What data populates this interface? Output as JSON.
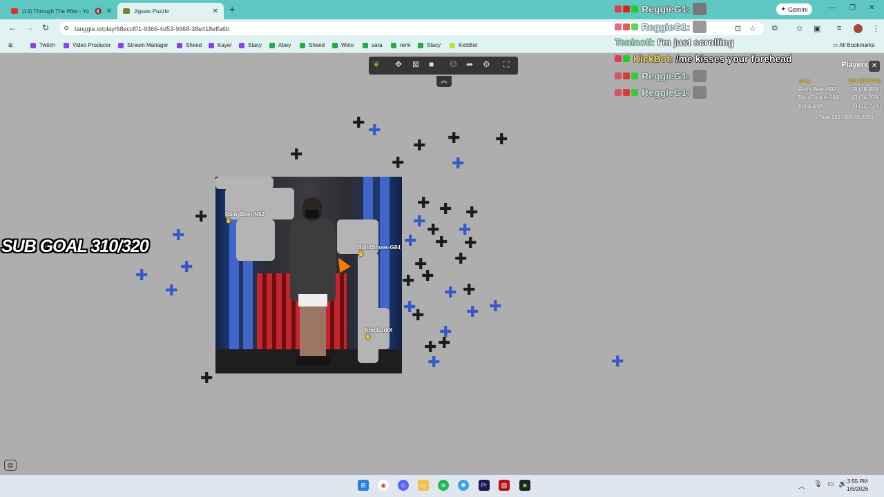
{
  "browser": {
    "tabs": [
      {
        "title": "(14) Through The Wire - Yo",
        "active": false
      },
      {
        "title": "Jigsaw Puzzle",
        "active": true
      }
    ],
    "new_tab": "+",
    "gemini": "Gemini",
    "url": "tanggle.io/play/68eccf01-9366-4d53-9968-38e418effa6b",
    "bookmarks": [
      "Twitch",
      "Video Producer",
      "Stream Manager",
      "Sheed",
      "Kayel",
      "Stacy",
      "Abey",
      "Sheed",
      "Welo",
      "sara",
      "remi",
      "Stacy",
      "KickBot"
    ],
    "all_bookmarks": "All Bookmarks",
    "colors": {
      "tabbar": "#5fc7c2",
      "toolbar": "#e0f3f2",
      "canvas": "#aeaeae"
    }
  },
  "puzzle": {
    "cursor_labels": [
      "RainyBeer-N92",
      "BlindShoes-G84",
      "KingLurkX"
    ],
    "toolbar_icons": [
      "leaf-icon",
      "puzzle-icon",
      "image-icon",
      "square-icon",
      "users-icon",
      "share-icon",
      "gear-icon",
      "fullscreen-icon"
    ]
  },
  "overlay": {
    "sub_goal": "SUB GOAL 310/320",
    "chat": [
      {
        "user": "ReggieG1:",
        "message": "",
        "emote": true,
        "faded": false
      },
      {
        "user": "ReggieG1:",
        "message": "",
        "emote": true,
        "faded": true
      },
      {
        "user": "Teninoti:",
        "message": "I'm just scrolling",
        "emote": false,
        "faded": true
      },
      {
        "user": "KickBot:",
        "message": "/me kisses your forehead",
        "emote": false,
        "faded": false
      },
      {
        "user": "ReggieG1:",
        "message": "",
        "emote": true,
        "faded": true
      },
      {
        "user": "ReggieG1:",
        "message": "",
        "emote": true,
        "faded": true
      }
    ]
  },
  "players": {
    "title": "Players",
    "list": [
      {
        "name": "abey",
        "score": "109 (35.62%)"
      },
      {
        "name": "RainyBeer-N92",
        "score": "58 (18.95%)"
      },
      {
        "name": "BlindShoes-G84",
        "score": "43 (14.05%)"
      },
      {
        "name": "KingLurkX",
        "score": "39 (12.75%)"
      }
    ],
    "total": "Total: 262 / 306 (85.62%)"
  },
  "taskbar": {
    "time": "3:55 PM",
    "date": "1/6/2026"
  }
}
